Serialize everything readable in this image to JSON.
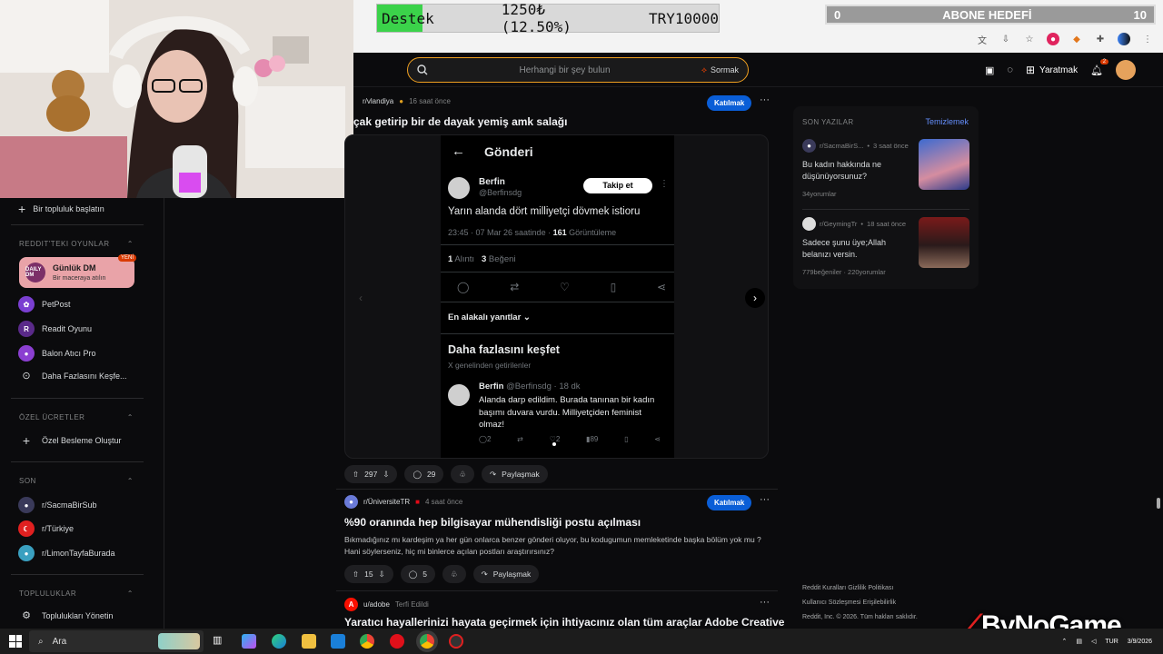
{
  "overlay": {
    "donation": {
      "label": "Destek",
      "amount": "1250₺ (12.50%)",
      "goal": "TRY10000",
      "progress_percent": 12.5
    },
    "sub_goal": {
      "current": "0",
      "label": "ABONE HEDEFİ",
      "target": "10"
    }
  },
  "header": {
    "search_placeholder": "Herhangi bir şey bulun",
    "ask_label": "Sormak",
    "create_label": "Yaratmak",
    "notif_count": "2"
  },
  "sidebar": {
    "start_community": "Bir topluluk başlatın",
    "games_title": "REDDIT'TEKI OYUNLAR",
    "daily_dm": {
      "title": "Günlük DM",
      "subtitle": "Bir maceraya atılın",
      "logo": "DAILY DM",
      "badge": "YENİ"
    },
    "games": [
      "PetPost",
      "Readit Oyunu",
      "Balon Atıcı Pro",
      "Daha Fazlasını Keşfe..."
    ],
    "custom_title": "ÖZEL ÜCRETLER",
    "custom_create": "Özel Besleme Oluştur",
    "recent_title": "SON",
    "recent": [
      "r/SacmaBirSub",
      "r/Türkiye",
      "r/LimonTayfaBurada"
    ],
    "communities_title": "TOPLULUKLAR",
    "manage": "Toplulukları Yönetin"
  },
  "posts": [
    {
      "sub": "r/vlandiya",
      "time": "16 saat önce",
      "join": "Katılmak",
      "title": "çak getirip bir de dayak yemiş amk salağı",
      "votes": "297",
      "comments": "29",
      "share": "Paylaşmak"
    },
    {
      "sub": "r/ÜniversiteTR",
      "time": "4 saat önce",
      "join": "Katılmak",
      "title": "%90 oranında hep bilgisayar mühendisliği postu açılması",
      "body": "Bıkmadığınız mı kardeşim ya her gün onlarca benzer gönderi oluyor, bu kodugumun memleketinde başka bölüm yok mu ? Hani söylerseniz, hiç mi binlerce açılan postları araştırırsınız?",
      "votes": "15",
      "comments": "5",
      "share": "Paylaşmak"
    },
    {
      "sub": "u/adobe",
      "time": "Terfi Edildi",
      "title": "Yaratıcı hayallerinizi hayata geçirmek için ihtiyacınız olan tüm araçlar Adobe Creative"
    }
  ],
  "tweet": {
    "header": "Gönderi",
    "name": "Berfin",
    "handle": "@Berfinsdg",
    "follow": "Takip et",
    "text": "Yarın alanda dört milliyetçi dövmek istioru",
    "meta_time": "23:45 · 07 Mar 26 saatinde · ",
    "views_count": "161",
    "views_label": " Görüntüleme",
    "quotes_count": "1",
    "quotes_label": " Alıntı",
    "likes_count": "3",
    "likes_label": " Beğeni",
    "relevant": "En alakalı yanıtlar",
    "discover": "Daha fazlasını keşfet",
    "discover_sub": "X genelinden getirilenler",
    "reply_name": "Berfin",
    "reply_meta": "@Berfinsdg · 18 dk",
    "reply_text": "Alanda darp edildim. Burada tanınan bir kadın başımı duvara vurdu. Milliyetçiden feminist olmaz!",
    "reply_stats": [
      "2",
      "2",
      "89"
    ]
  },
  "recent_posts": {
    "title": "SON YAZILAR",
    "clear": "Temizlemek",
    "items": [
      {
        "sub": "r/SacmaBirS...",
        "time": "3 saat önce",
        "title": "Bu kadın hakkında ne düşünüyorsunuz?",
        "stats": "34yorumlar"
      },
      {
        "sub": "r/GeymingTr",
        "time": "18 saat önce",
        "title": "Sadece şunu üye;Allah belanızı versin.",
        "stats": "779beğeniler · 220yorumlar"
      }
    ]
  },
  "footer": {
    "line1": "Reddit Kuralları   Gizlilik Politikası",
    "line2": "Kullanıcı Sözleşmesi   Erişilebilirlik",
    "line3": "Reddit, Inc. © 2026. Tüm hakları saklıdır."
  },
  "taskbar": {
    "search": "Ara",
    "lang": "TUR",
    "date": "3/9/2026"
  },
  "watermark": "ByNoGame",
  "colors": {
    "accent_join": "#0a5ed7",
    "search_border": "#f0a020",
    "donation_fill": "#3bd24a"
  }
}
